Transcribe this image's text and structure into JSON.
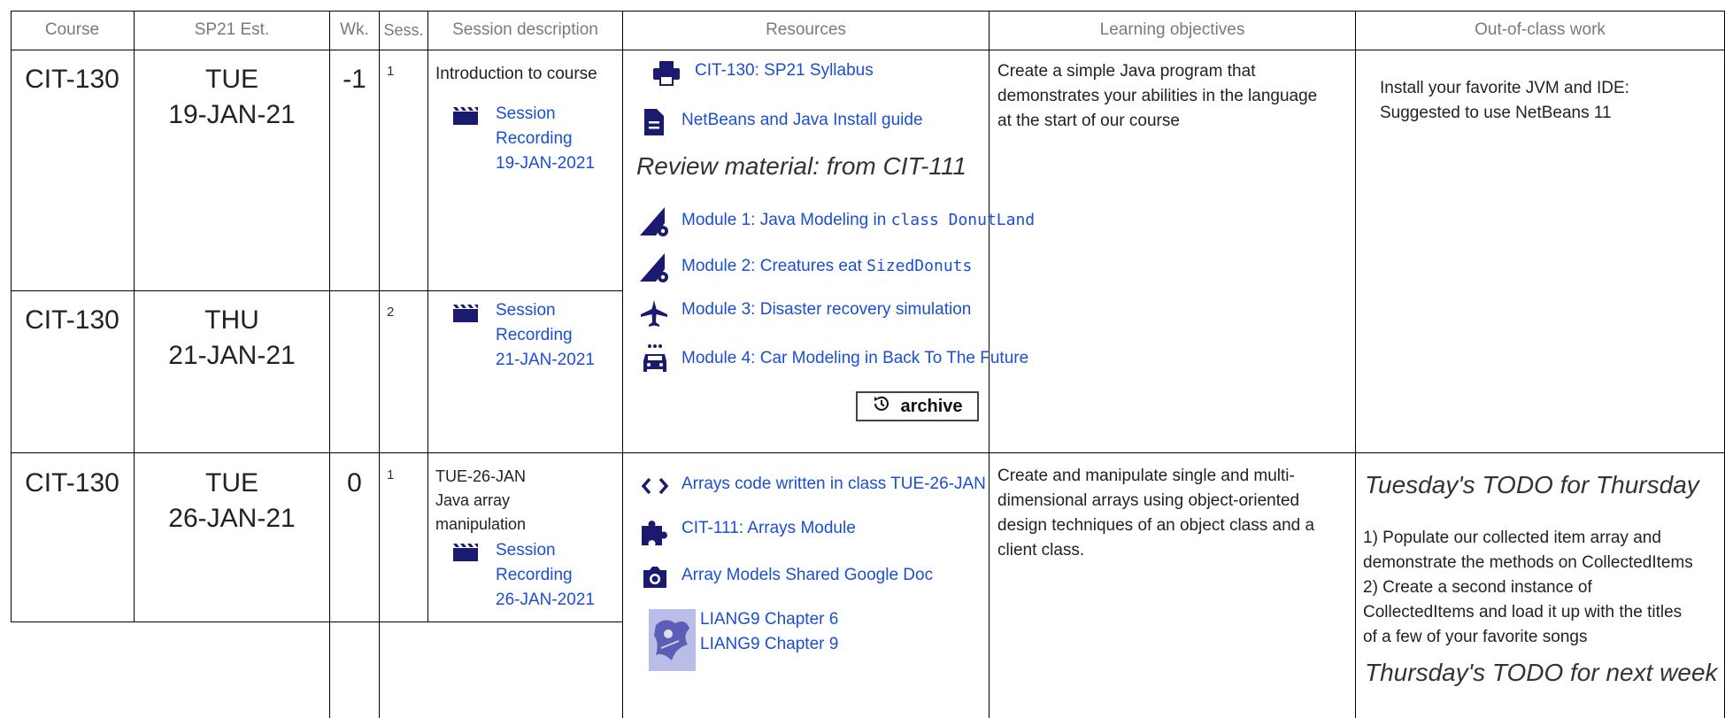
{
  "headers": {
    "course": "Course",
    "est": "SP21 Est.",
    "week": "Wk.",
    "session": "Sess.",
    "description": "Session description",
    "resources": "Resources",
    "objectives": "Learning objectives",
    "work": "Out-of-class work"
  },
  "rows": [
    {
      "course": "CIT-130",
      "day": "TUE",
      "date": "19-JAN-21",
      "week": "-1",
      "session": "1",
      "description": "Introduction to course",
      "recording": [
        "Session",
        "Recording",
        "19-JAN-2021"
      ]
    },
    {
      "course": "CIT-130",
      "day": "THU",
      "date": "21-JAN-21",
      "session": "2",
      "recording": [
        "Session",
        "Recording",
        "21-JAN-2021"
      ]
    },
    {
      "course": "CIT-130",
      "day": "TUE",
      "date": "26-JAN-21",
      "week": "0",
      "session": "1",
      "description_lines": [
        "TUE-26-JAN",
        "Java array",
        "manipulation"
      ],
      "recording": [
        "Session",
        "Recording",
        "26-JAN-2021"
      ]
    }
  ],
  "week1": {
    "resources": {
      "syllabus": "CIT-130: SP21 Syllabus",
      "install_guide": "NetBeans and Java Install guide",
      "review_heading": "Review material: from CIT-111",
      "module1_text": "Module 1: Java Modeling in ",
      "module1_code": "class DonutLand",
      "module2_text": "Module 2: Creatures eat ",
      "module2_code": "SizedDonuts",
      "module3": "Module 3: Disaster recovery simulation",
      "module4": "Module 4: Car Modeling in Back To The Future",
      "archive": "archive"
    },
    "objective_lines": [
      "Create a simple Java program that",
      "demonstrates your abilities in the language",
      "at the start of our course"
    ],
    "work_lines": [
      "Install your favorite JVM and IDE:",
      "Suggested to use NetBeans 11"
    ]
  },
  "week2": {
    "resources": {
      "arrays_code": "Arrays code written in class TUE-26-JAN",
      "arrays_module": "CIT-111: Arrays Module",
      "google_doc": "Array Models Shared Google Doc",
      "liang6": "LIANG9 Chapter 6",
      "liang9": "LIANG9 Chapter 9"
    },
    "objective_lines": [
      "Create and manipulate single and multi-",
      "dimensional arrays using object-oriented",
      "design techniques of an object class and a",
      "client class."
    ],
    "todo_thursday": "Tuesday's TODO for Thursday",
    "todo_lines": [
      "1) Populate our collected item array and",
      "demonstrate the methods on CollectedItems",
      "2) Create a second instance of",
      "CollectedItems and load it up with the titles",
      "of a few of your favorite songs"
    ],
    "todo_next_week": "Thursday's TODO for next week"
  },
  "icons": {
    "syllabus": "printer-icon",
    "install_guide": "document-icon",
    "module1": "drafting-gear-icon",
    "module2": "drafting-gear-icon",
    "module3": "airplane-icon",
    "module4": "car-icon",
    "archive": "history-icon",
    "recording": "clapperboard-icon",
    "arrays_code": "code-brackets-icon",
    "arrays_module": "puzzle-piece-icon",
    "google_doc": "camera-icon",
    "liang_cover": "book-cover-image"
  },
  "colors": {
    "link": "#1a4fd0",
    "icon": "#1a1a6e",
    "header_text": "#7a7a7a"
  }
}
